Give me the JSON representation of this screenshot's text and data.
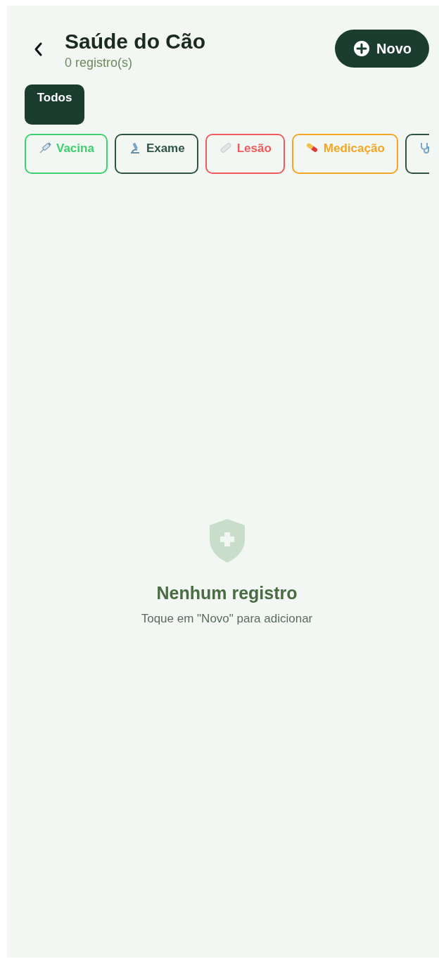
{
  "header": {
    "title": "Saúde do Cão",
    "subtitle": "0 registro(s)",
    "new_button": "Novo"
  },
  "filters": [
    {
      "label": "Todos",
      "selected": true
    }
  ],
  "categories": [
    {
      "kind": "syringe",
      "label": "Vacina",
      "color": "#3ecf6e",
      "selected": false
    },
    {
      "kind": "microscope",
      "label": "Exame",
      "color": "#2f5446",
      "selected": false
    },
    {
      "kind": "bandage",
      "label": "Lesão",
      "color": "#ef5a5a",
      "selected": false
    },
    {
      "kind": "pill",
      "label": "Medicação",
      "color": "#f5a524",
      "selected": false
    },
    {
      "kind": "stethoscope",
      "color": "#2f5446",
      "selected": false
    }
  ],
  "empty_state": {
    "title": "Nenhum registro",
    "message": "Toque em \"Novo\" para adicionar"
  }
}
